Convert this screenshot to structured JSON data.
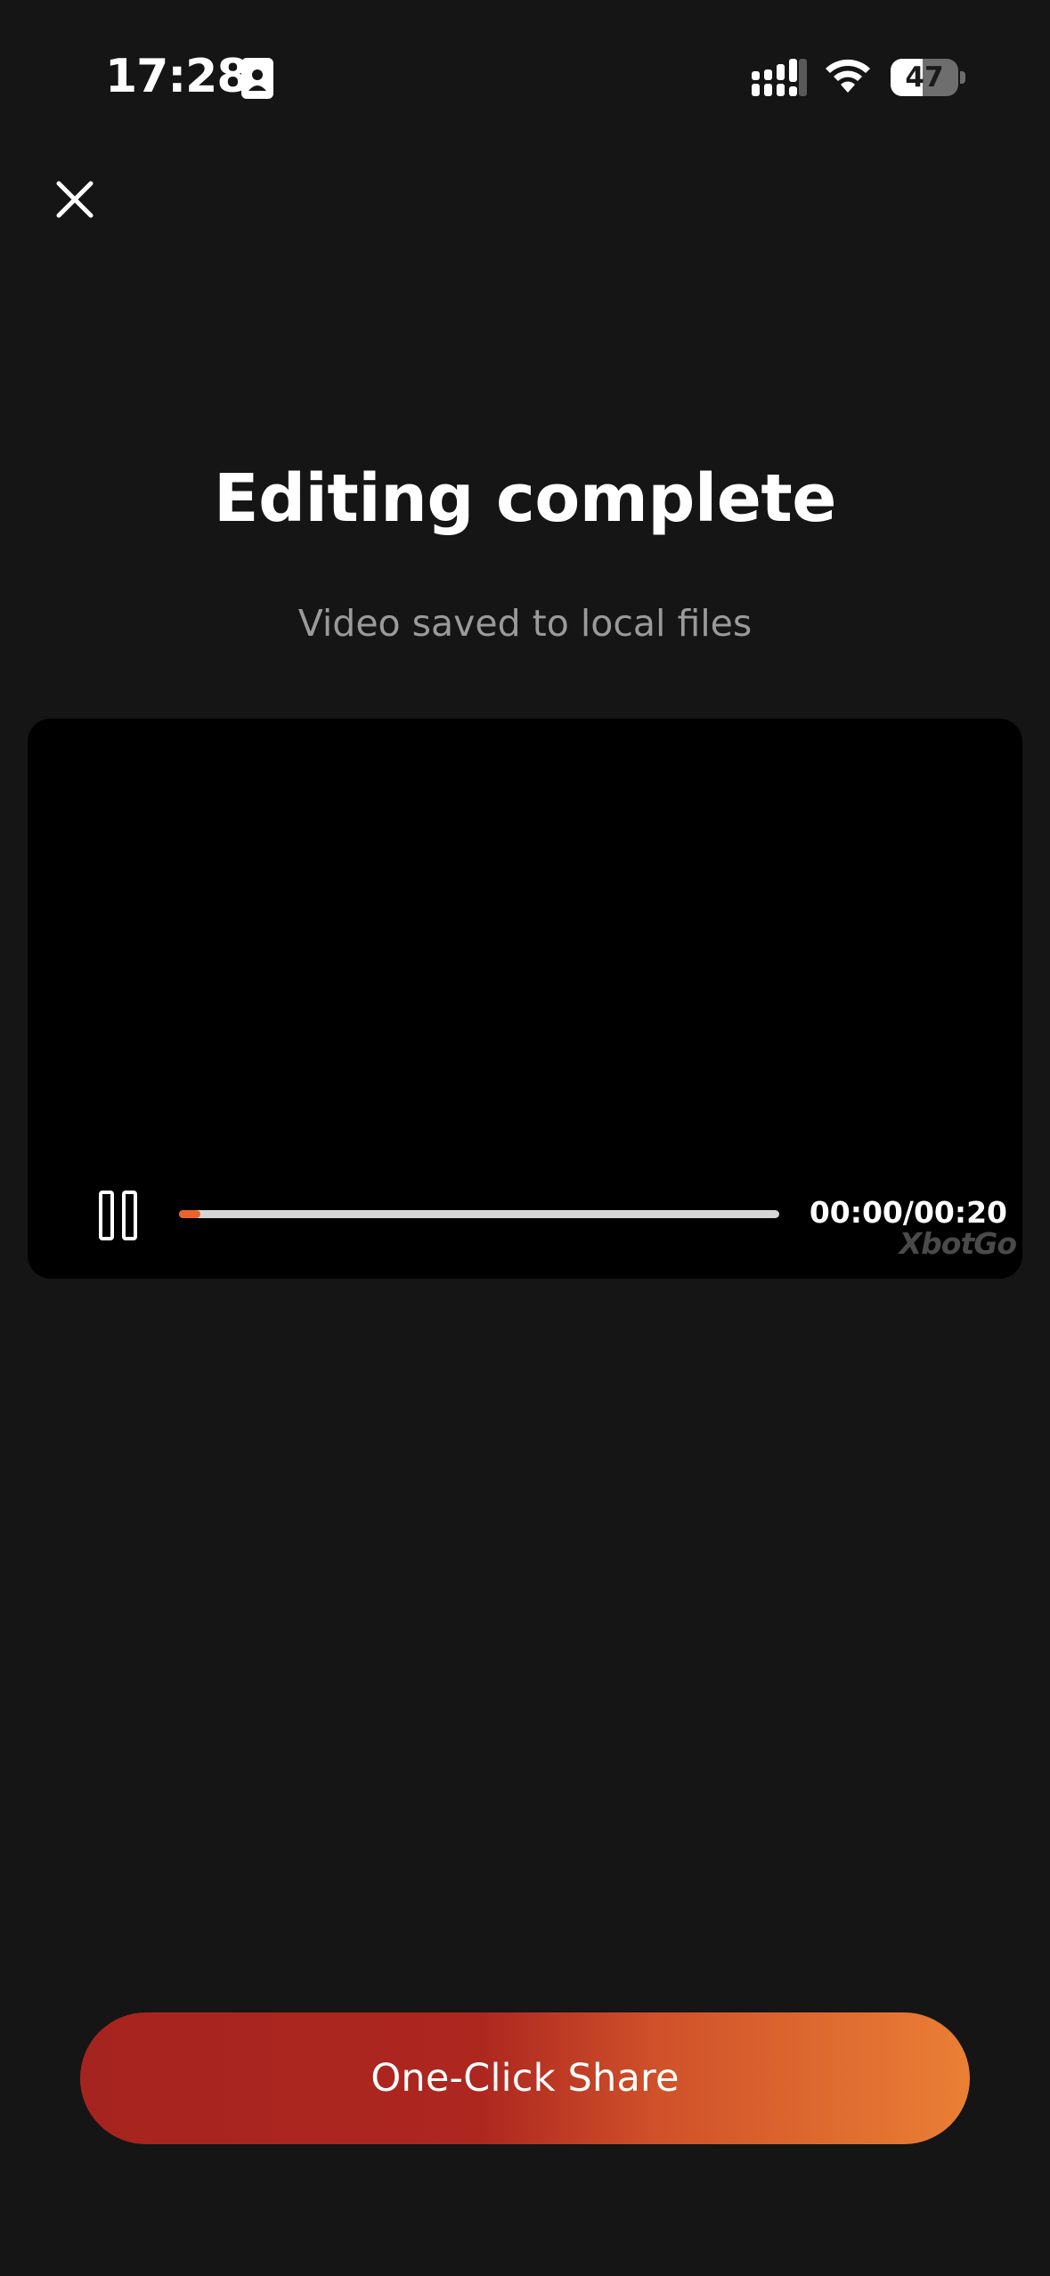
{
  "status_bar": {
    "time": "17:28",
    "battery_level": "47",
    "battery_fraction": 0.47,
    "icons": [
      "id-card-icon",
      "cellular-signal-icon",
      "wifi-icon",
      "battery-icon"
    ]
  },
  "header": {
    "close_icon": "close-icon"
  },
  "main": {
    "title": "Editing complete",
    "subtitle": "Video saved to local files"
  },
  "player": {
    "control_icon": "pause-icon",
    "current_time": "00:00",
    "separator": "/",
    "total_time": "00:20",
    "progress_fraction": 0.035,
    "watermark": "XbotGo"
  },
  "actions": {
    "share_label": "One-Click Share"
  },
  "colors": {
    "background": "#151515",
    "accent": "#e8642b",
    "gradient_start": "#a6241f",
    "gradient_end": "#ea7f35",
    "muted_text": "#9a9a9a"
  }
}
